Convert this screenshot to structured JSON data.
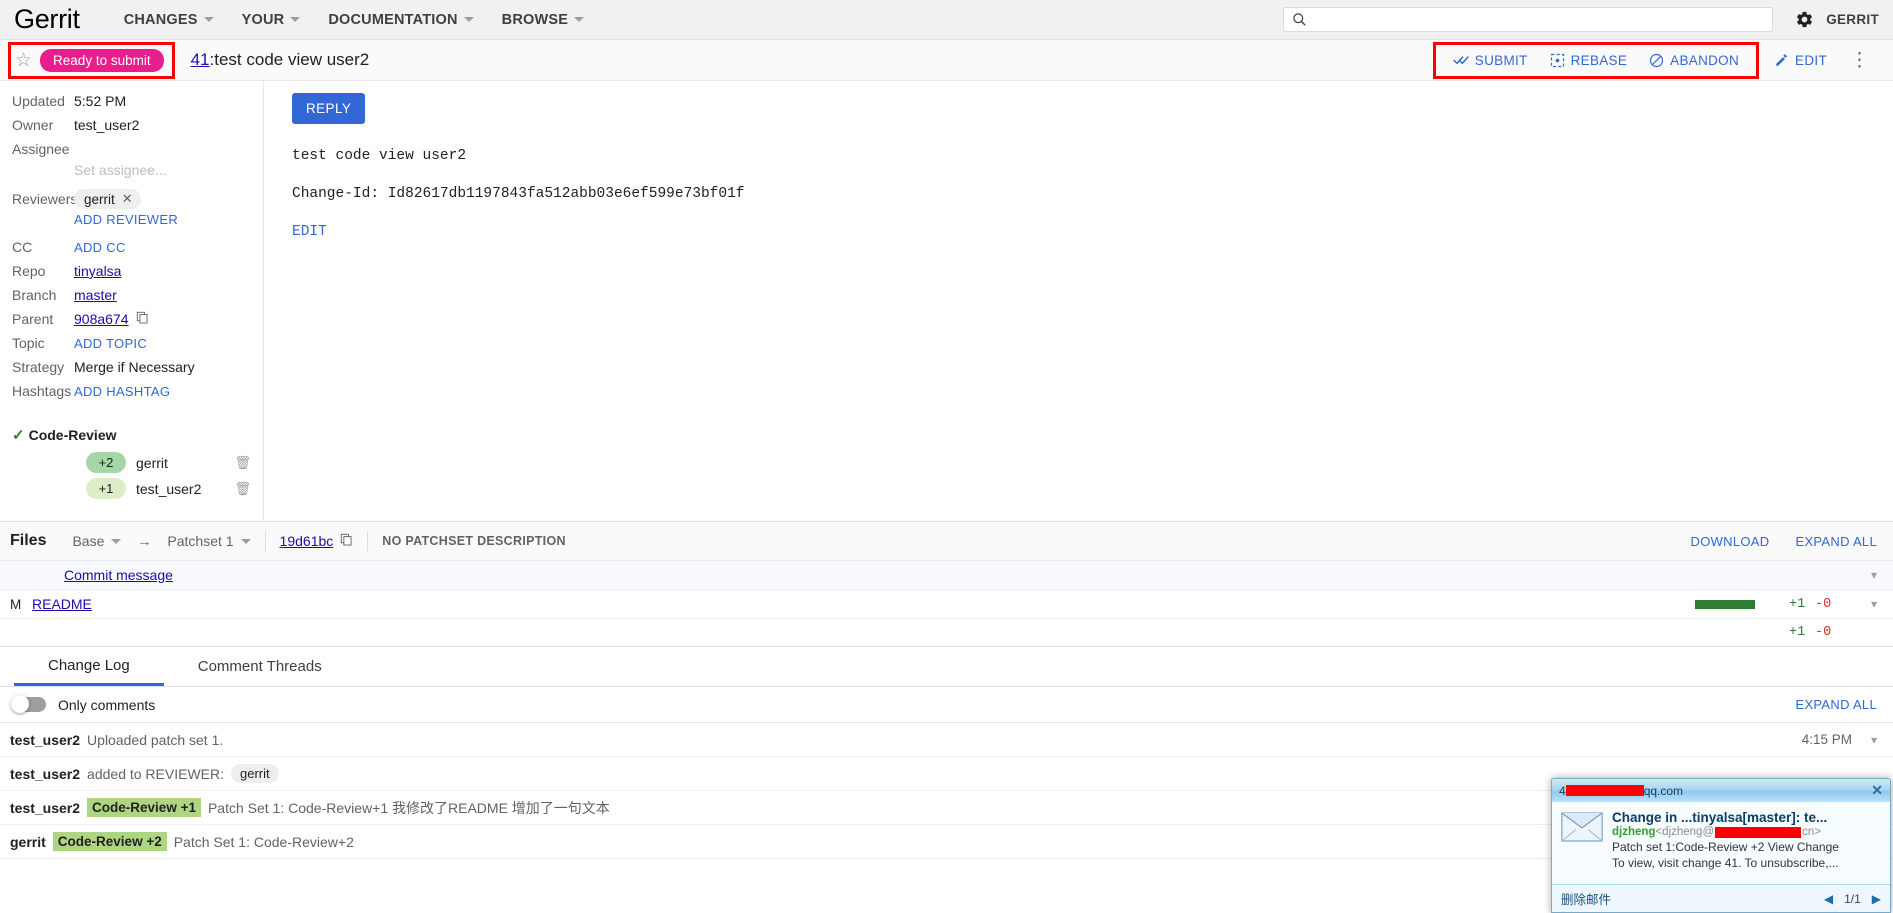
{
  "topnav": {
    "brand": "Gerrit",
    "items": [
      {
        "label": "CHANGES"
      },
      {
        "label": "YOUR"
      },
      {
        "label": "DOCUMENTATION"
      },
      {
        "label": "BROWSE"
      }
    ],
    "search_placeholder": "",
    "search_value": "",
    "user_label": "GERRIT"
  },
  "change": {
    "status": "Ready to submit",
    "number": "41",
    "separator": ": ",
    "title": "test code view user2",
    "actions": [
      {
        "label": "SUBMIT",
        "icon": "double-check-icon"
      },
      {
        "label": "REBASE",
        "icon": "rebase-icon"
      },
      {
        "label": "ABANDON",
        "icon": "block-icon"
      },
      {
        "label": "EDIT",
        "icon": "pencil-icon"
      }
    ]
  },
  "metadata": {
    "updated_label": "Updated",
    "updated_value": "5:52 PM",
    "owner_label": "Owner",
    "owner_value": "test_user2",
    "assignee_label": "Assignee",
    "assignee_placeholder": "Set assignee...",
    "reviewers_label": "Reviewers",
    "reviewer_chip": "gerrit",
    "add_reviewer": "ADD REVIEWER",
    "cc_label": "CC",
    "add_cc": "ADD CC",
    "repo_label": "Repo",
    "repo_value": "tinyalsa",
    "branch_label": "Branch",
    "branch_value": "master",
    "parent_label": "Parent",
    "parent_value": "908a674",
    "topic_label": "Topic",
    "add_topic": "ADD TOPIC",
    "strategy_label": "Strategy",
    "strategy_value": "Merge if Necessary",
    "hashtags_label": "Hashtags",
    "add_hashtag": "ADD HASHTAG"
  },
  "labels": {
    "name": "Code-Review",
    "votes": [
      {
        "score": "+2",
        "user": "gerrit",
        "tone": "v2"
      },
      {
        "score": "+1",
        "user": "test_user2",
        "tone": "v1"
      }
    ]
  },
  "content": {
    "reply_label": "REPLY",
    "commit_subject": "test code view user2",
    "commit_changeid": "Change-Id: Id82617db1197843fa512abb03e6ef599e73bf01f",
    "edit_label": "EDIT"
  },
  "files": {
    "title": "Files",
    "base_label": "Base",
    "arrow": "→",
    "patchset_label": "Patchset 1",
    "sha": "19d61bc",
    "no_description": "NO PATCHSET DESCRIPTION",
    "download_label": "DOWNLOAD",
    "expand_all_label": "EXPAND ALL",
    "rows": [
      {
        "status": "",
        "name": "Commit message",
        "added": "",
        "removed": "",
        "has_bar": false
      },
      {
        "status": "M",
        "name": "README",
        "added": "+1",
        "removed": "-0",
        "has_bar": true
      }
    ],
    "totals": {
      "added": "+1",
      "removed": "-0"
    }
  },
  "tabs": {
    "items": [
      {
        "label": "Change Log",
        "active": true
      },
      {
        "label": "Comment Threads",
        "active": false
      }
    ],
    "only_comments_label": "Only comments",
    "expand_all_label": "EXPAND ALL"
  },
  "changelog": [
    {
      "actor": "test_user2",
      "vote": "",
      "chip": "",
      "text": "Uploaded patch set 1.",
      "time": "4:15 PM",
      "has_chevron": true
    },
    {
      "actor": "test_user2",
      "vote": "",
      "chip": "gerrit",
      "text": "added to REVIEWER:",
      "time": "",
      "has_chevron": false
    },
    {
      "actor": "test_user2",
      "vote": "Code-Review +1",
      "chip": "",
      "text": "Patch Set 1: Code-Review+1 我修改了README 增加了一句文本",
      "time": "",
      "has_chevron": false
    },
    {
      "actor": "gerrit",
      "vote": "Code-Review +2",
      "chip": "",
      "text": "Patch Set 1: Code-Review+2",
      "time": "",
      "has_chevron": false
    }
  ],
  "toast": {
    "address_prefix": "4",
    "address_suffix": "qq.com",
    "subject": "Change in ...tinyalsa[master]: te...",
    "from_name": "djzheng",
    "from_addr_prefix": "<djzheng@",
    "from_addr_suffix": "cn>",
    "line1": "Patch set 1:Code-Review +2 View Change",
    "line2": "To view, visit change 41. To unsubscribe,...",
    "delete_label": "删除邮件",
    "page": "1/1",
    "prev": "◀",
    "next": "▶",
    "close": "✕"
  }
}
